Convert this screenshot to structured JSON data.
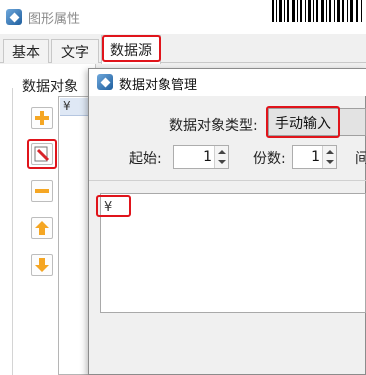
{
  "outer_dialog": {
    "title": "图形属性",
    "icon": "app-icon"
  },
  "tabs": [
    {
      "label": "基本"
    },
    {
      "label": "文字"
    },
    {
      "label": "数据源",
      "active": true
    }
  ],
  "left_panel": {
    "label": "数据对象",
    "toolbar": [
      {
        "name": "add-button",
        "icon": "plus-icon"
      },
      {
        "name": "edit-button",
        "icon": "edit-icon"
      },
      {
        "name": "remove-button",
        "icon": "minus-icon"
      },
      {
        "name": "move-up-button",
        "icon": "arrow-up-icon"
      },
      {
        "name": "move-down-button",
        "icon": "arrow-down-icon"
      }
    ],
    "list_items": [
      "¥"
    ]
  },
  "inner_dialog": {
    "title": "数据对象管理",
    "type_label": "数据对象类型:",
    "type_value": "手动输入",
    "start_label": "起始:",
    "start_value": "1",
    "copies_label": "份数:",
    "copies_value": "1",
    "interval_label": "间",
    "content_text": "¥"
  },
  "colors": {
    "highlight": "#e0141b",
    "icon_orange": "#f5a623"
  }
}
